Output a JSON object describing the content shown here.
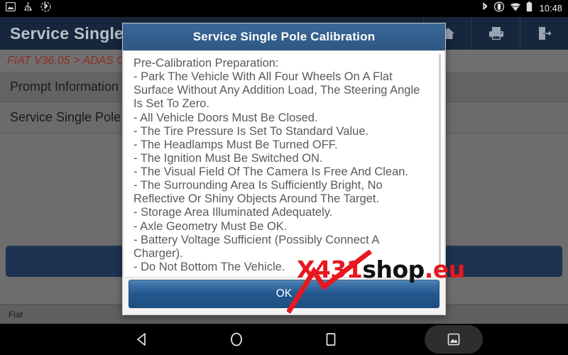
{
  "status_bar": {
    "time": "10:48",
    "left_icons": [
      "screenshot-icon",
      "usb-icon",
      "bluetooth-circle-icon"
    ],
    "right_icons": [
      "bluetooth-icon",
      "screen-rotation-icon",
      "wifi-icon",
      "battery-icon"
    ]
  },
  "app": {
    "title": "Service Single P",
    "breadcrumb": "FIAT V36.05 > ADAS Ca",
    "section_label": "Prompt Information",
    "row_label": "Service Single Pole C",
    "footer_label": "Fiat",
    "toolbar_icons": [
      "home-icon",
      "print-icon",
      "exit-icon"
    ]
  },
  "dialog": {
    "title": "Service Single Pole Calibration",
    "lines": [
      "Pre-Calibration Preparation:",
      " - Park The Vehicle With All Four Wheels On A Flat Surface Without Any Addition Load, The Steering Angle Is Set To Zero.",
      " - All Vehicle Doors Must Be Closed.",
      " - The Tire Pressure Is Set To Standard Value.",
      " - The Headlamps Must Be Turned OFF.",
      " - The Ignition Must Be Switched ON.",
      " - The Visual Field Of The Camera Is Free And Clean.",
      " - The Surrounding Area Is Sufficiently Bright, No Reflective Or Shiny Objects Around The Target.",
      " - Storage Area Illuminated Adequately.",
      " - Axle Geometry Must Be OK.",
      " - Battery Voltage Sufficient (Possibly Connect A Charger).",
      " - Do Not Bottom The Vehicle."
    ],
    "ok_label": "OK"
  },
  "watermark": {
    "part1": "X",
    "part2": "431",
    "part3": "shop",
    "part4": ".eu",
    "color_red": "#e8171f",
    "color_black": "#111111"
  },
  "nav_bar": {
    "buttons": [
      "back-icon",
      "home-icon",
      "recents-icon",
      "screenshot-icon"
    ]
  },
  "colors": {
    "app_header": "#16263c",
    "dialog_header": "#35618f",
    "breadcrumb": "#8c2e22",
    "ok_button": "#23598f"
  }
}
